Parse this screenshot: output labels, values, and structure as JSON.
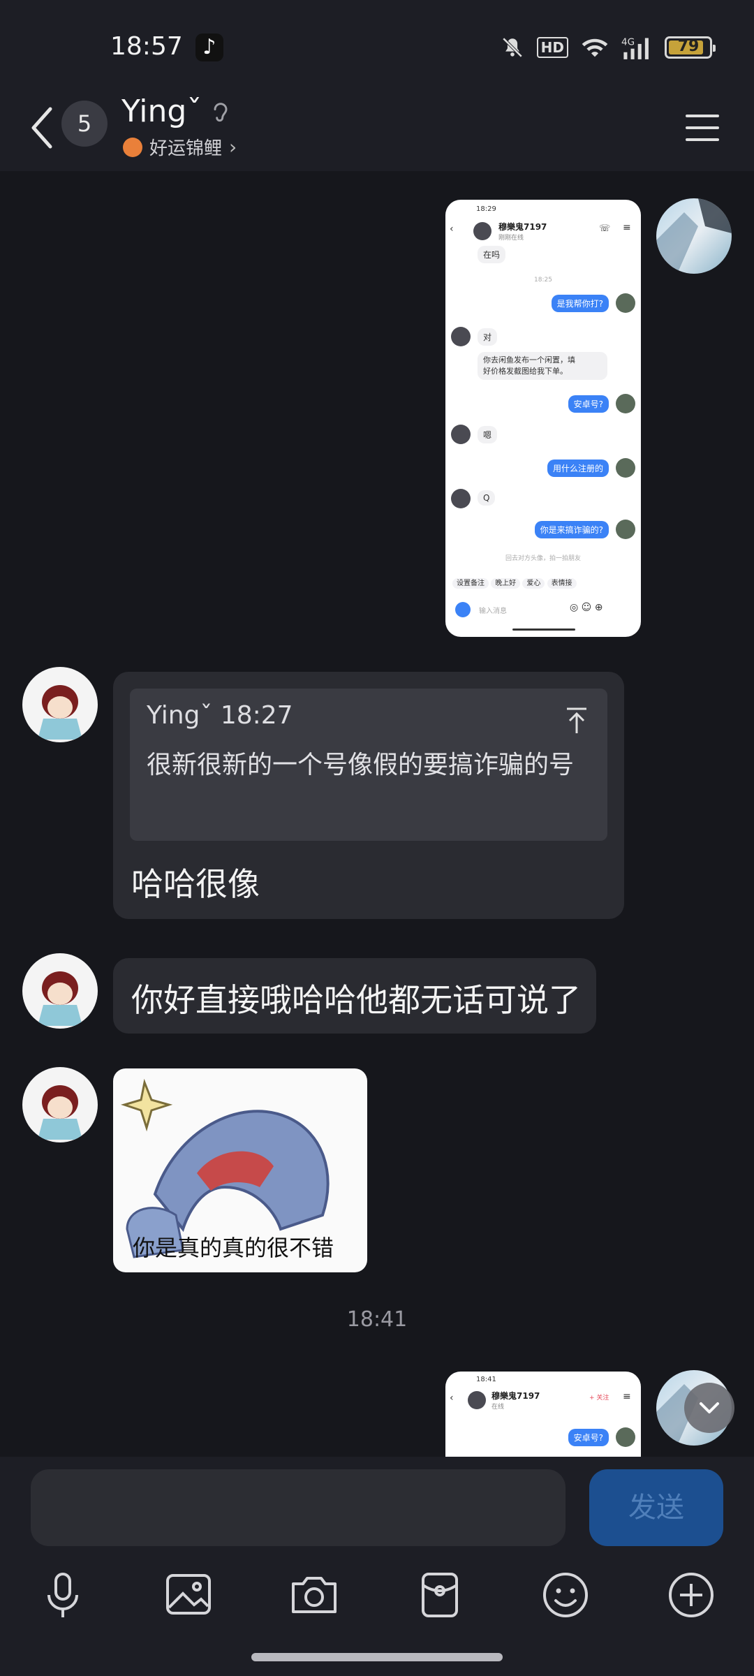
{
  "status": {
    "time": "18:57",
    "battery": "79",
    "network": "4G",
    "hd": "HD"
  },
  "header": {
    "unread": "5",
    "name": "Yingˇ",
    "subtitle": "好运锦鲤"
  },
  "shot1": {
    "time": "18:29",
    "contact": "穆樂鬼7197",
    "contact_status": "刚刚在线",
    "msgs": [
      "在吗",
      "18:25",
      "是我帮你打?",
      "对",
      "你去闲鱼发布一个闲置，填",
      "好价格发截图给我下单。",
      "安卓号?",
      "嗯",
      "用什么注册的",
      "Q",
      "你是来搞诈骗的?",
      "回去对方头像，拍一拍朋友"
    ],
    "chips": [
      "设置备注",
      "晚上好",
      "爱心",
      "表情接"
    ],
    "input_placeholder": "输入消息"
  },
  "quote": {
    "head": "Yingˇ 18:27",
    "text": "很新很新的一个号像假的要搞诈骗的号"
  },
  "messages": {
    "reply": "哈哈很像",
    "second": "你好直接哦哈哈他都无话可说了",
    "sticker_caption": "你是真的真的很不错"
  },
  "timestamp": "18:41",
  "shot2": {
    "time": "18:41",
    "contact": "穆樂鬼7197",
    "status": "在线",
    "follow": "+ 关注",
    "msg": "安卓号?"
  },
  "composer": {
    "send": "发送"
  }
}
